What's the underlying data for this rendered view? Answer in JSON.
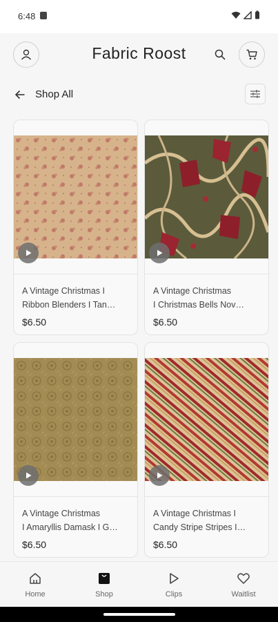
{
  "status_bar": {
    "time": "6:48"
  },
  "header": {
    "brand": "Fabric Roost"
  },
  "subheader": {
    "title": "Shop All"
  },
  "products": [
    {
      "line1": "A Vintage Christmas I",
      "line2": "Ribbon Blenders I Tan…",
      "price": "$6.50"
    },
    {
      "line1": "A Vintage Christmas",
      "line2": "I Christmas Bells Nov…",
      "price": "$6.50"
    },
    {
      "line1": "A Vintage Christmas",
      "line2": "I Amaryllis Damask I G…",
      "price": "$6.50"
    },
    {
      "line1": "A Vintage Christmas I",
      "line2": "Candy Stripe Stripes I…",
      "price": "$6.50"
    }
  ],
  "nav": {
    "home": "Home",
    "shop": "Shop",
    "clips": "Clips",
    "waitlist": "Waitlist"
  },
  "colors": {
    "background": "#f6f6f6",
    "tan_fabric": "#d8b48c",
    "olive_fabric": "#5a5a3a",
    "damask_fabric": "#a08a50",
    "stripe_red": "#9b2a2a"
  },
  "icons": [
    "account-icon",
    "search-icon",
    "cart-icon",
    "back-arrow-icon",
    "filter-icon",
    "play-icon",
    "home-icon",
    "shop-bag-icon",
    "clips-play-icon",
    "heart-icon"
  ]
}
